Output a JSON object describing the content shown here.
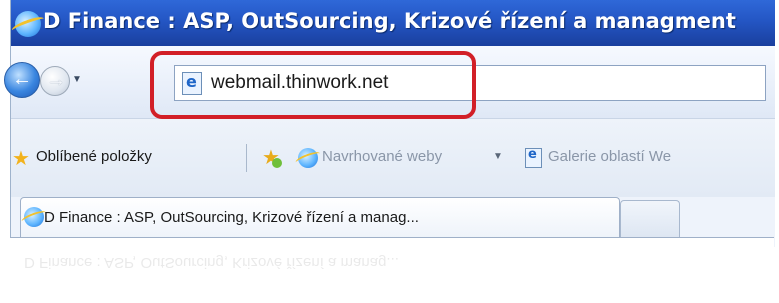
{
  "window": {
    "title": "D Finance : ASP, OutSourcing, Krizové řízení a managment"
  },
  "navigation": {
    "back_icon": "back-arrow-icon",
    "forward_icon": "forward-arrow-icon",
    "history_dropdown_icon": "chevron-down-icon"
  },
  "addressbar": {
    "url": "webmail.thinwork.net",
    "page_icon": "ie-page-icon"
  },
  "favorites_bar": {
    "favorites_label": "Oblíbené položky",
    "suggested_sites_label": "Navrhované weby",
    "web_slice_gallery_label": "Galerie oblastí We"
  },
  "tabs": [
    {
      "label": "D Finance : ASP, OutSourcing, Krizové řízení a manag..."
    }
  ],
  "colors": {
    "titlebar": "#2456c4",
    "highlight_annotation": "#d21f27"
  }
}
